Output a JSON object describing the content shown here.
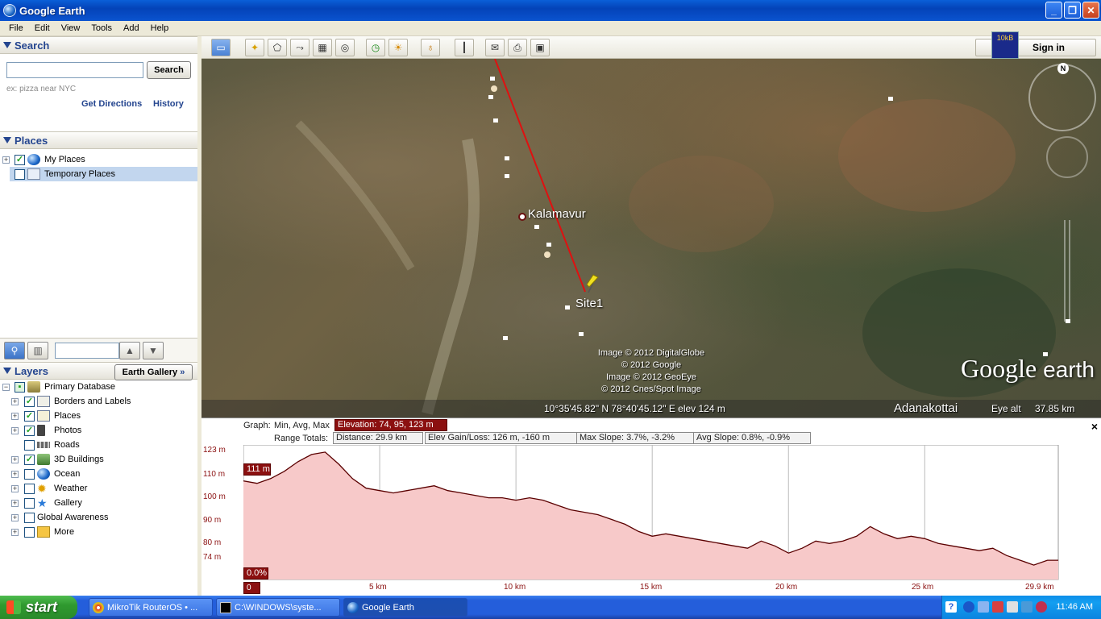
{
  "window": {
    "title": "Google Earth"
  },
  "menu": [
    "File",
    "Edit",
    "View",
    "Tools",
    "Add",
    "Help"
  ],
  "search": {
    "header": "Search",
    "input_value": "",
    "button": "Search",
    "hint": "ex: pizza near NYC",
    "get_directions": "Get Directions",
    "history": "History"
  },
  "places": {
    "header": "Places",
    "items": [
      {
        "label": "My Places"
      },
      {
        "label": "Temporary Places"
      }
    ]
  },
  "layers": {
    "header": "Layers",
    "gallery_button": "Earth Gallery",
    "gallery_arrows": "»",
    "items": [
      {
        "label": "Primary Database"
      },
      {
        "label": "Borders and Labels"
      },
      {
        "label": "Places"
      },
      {
        "label": "Photos"
      },
      {
        "label": "Roads"
      },
      {
        "label": "3D Buildings"
      },
      {
        "label": "Ocean"
      },
      {
        "label": "Weather"
      },
      {
        "label": "Gallery"
      },
      {
        "label": "Global Awareness"
      },
      {
        "label": "More"
      }
    ]
  },
  "toolbar": {
    "sign_in": "Sign in",
    "net_monitor": "10kB"
  },
  "map": {
    "labels": {
      "kalamavur": "Kalamavur",
      "site1": "Site1",
      "adanakottai": "Adanakottai"
    },
    "credits": [
      "Image © 2012 DigitalGlobe",
      "© 2012 Google",
      "Image © 2012 GeoEye",
      "© 2012 Cnes/Spot Image"
    ],
    "logo_google": "Google",
    "logo_earth": "earth",
    "compass_n": "N",
    "status": {
      "coords": "10°35'45.82\" N  78°40'45.12\" E  elev   124 m",
      "eye_alt_label": "Eye alt",
      "eye_alt_value": "37.85 km"
    }
  },
  "profile": {
    "graph_label": "Graph:",
    "graph_modes": "Min, Avg, Max",
    "elevation": "Elevation: 74, 95, 123 m",
    "range_totals": "Range Totals:",
    "distance": "Distance: 29.9 km",
    "elev_gain": "Elev Gain/Loss: 126 m, -160 m",
    "max_slope": "Max Slope: 3.7%, -3.2%",
    "avg_slope": "Avg Slope: 0.8%, -0.9%",
    "current_elev": "111 m",
    "current_slope": "0.0%",
    "start_distance": "0 m",
    "close": "×"
  },
  "chart_data": {
    "type": "area",
    "y_ticks": [
      "123 m",
      "110 m",
      "100 m",
      "90 m",
      "80 m",
      "74 m"
    ],
    "x_ticks": [
      "5 km",
      "10 km",
      "15 km",
      "20 km",
      "25 km",
      "29.9 km"
    ],
    "ylim": [
      74,
      123
    ],
    "xlim": [
      0,
      29.9
    ],
    "x": [
      0,
      0.5,
      1,
      1.5,
      2,
      2.5,
      3,
      3.5,
      4,
      4.5,
      5,
      5.5,
      6,
      6.5,
      7,
      7.5,
      8,
      8.5,
      9,
      9.5,
      10,
      10.5,
      11,
      11.5,
      12,
      12.5,
      13,
      13.5,
      14,
      14.5,
      15,
      15.5,
      16,
      16.5,
      17,
      17.5,
      18,
      18.5,
      19,
      19.5,
      20,
      20.5,
      21,
      21.5,
      22,
      22.5,
      23,
      23.5,
      24,
      24.5,
      25,
      25.5,
      26,
      26.5,
      27,
      27.5,
      28,
      28.5,
      29,
      29.5,
      29.9
    ],
    "y": [
      111,
      110,
      112,
      115,
      119,
      122,
      123,
      118,
      112,
      108,
      107,
      106,
      107,
      108,
      109,
      107,
      106,
      105,
      104,
      104,
      103,
      104,
      103,
      101,
      99,
      98,
      97,
      95,
      93,
      90,
      88,
      89,
      88,
      87,
      86,
      85,
      84,
      83,
      86,
      84,
      81,
      83,
      86,
      85,
      86,
      88,
      92,
      89,
      87,
      88,
      87,
      85,
      84,
      83,
      82,
      83,
      80,
      78,
      76,
      78,
      78
    ]
  },
  "taskbar": {
    "start": "start",
    "tasks": [
      {
        "label": "MikroTik RouterOS • ..."
      },
      {
        "label": "C:\\WINDOWS\\syste..."
      },
      {
        "label": "Google Earth"
      }
    ],
    "clock": "11:46 AM"
  },
  "colors": {
    "route": "#e01010",
    "profile_line": "#5a0000",
    "profile_fill": "#f7c9c9",
    "accent": "#24458f"
  }
}
